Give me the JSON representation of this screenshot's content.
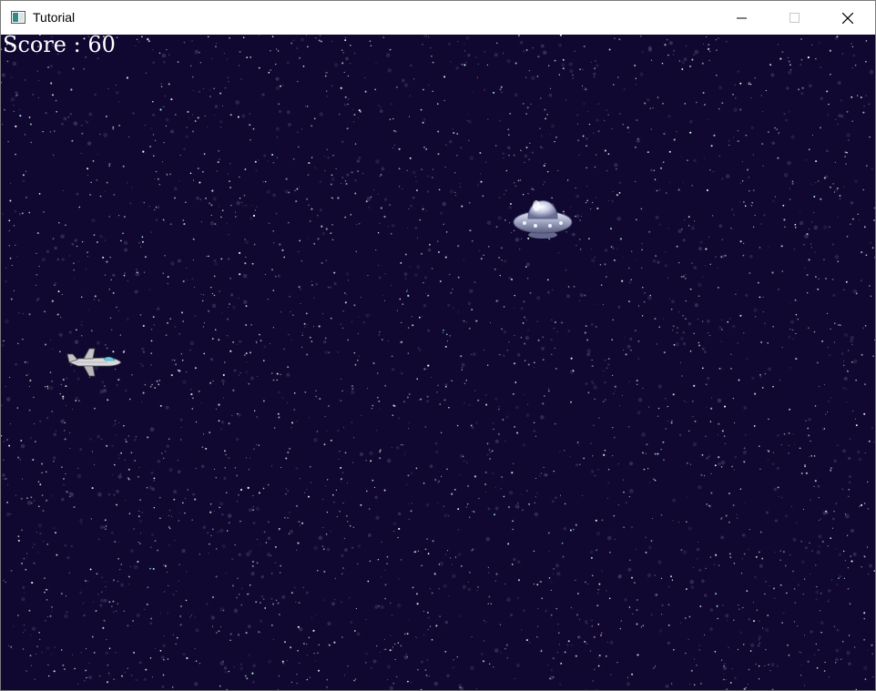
{
  "window": {
    "title": "Tutorial",
    "controls": [
      "minimize-icon",
      "maximize-icon",
      "close-icon"
    ]
  },
  "game": {
    "background_color": "#100830",
    "score_label": "Score",
    "score_separator": " : ",
    "score_value": "60",
    "player_sprite": "fighter-jet-icon",
    "enemy_sprite": "ufo-icon"
  }
}
